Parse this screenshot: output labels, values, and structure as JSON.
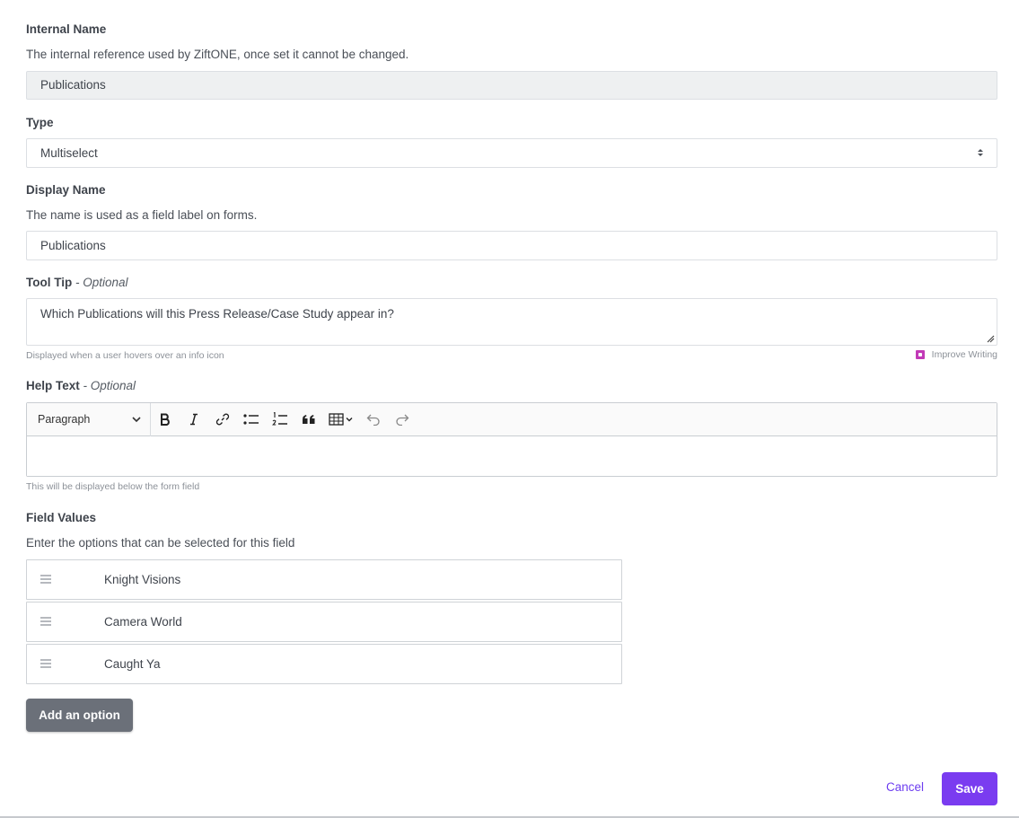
{
  "internal_name": {
    "label": "Internal Name",
    "description": "The internal reference used by ZiftONE, once set it cannot be changed.",
    "value": "Publications"
  },
  "type": {
    "label": "Type",
    "value": "Multiselect"
  },
  "display_name": {
    "label": "Display Name",
    "description": "The name is used as a field label on forms.",
    "value": "Publications"
  },
  "tool_tip": {
    "label": "Tool Tip",
    "optional": "- Optional",
    "value": "Which Publications will this Press Release/Case Study appear in?",
    "hint": "Displayed when a user hovers over an info icon",
    "improve_label": "Improve Writing"
  },
  "help_text": {
    "label": "Help Text",
    "optional": "- Optional",
    "paragraph_select": "Paragraph",
    "hint": "This will be displayed below the form field",
    "toolbar_icons": [
      "bold-icon",
      "italic-icon",
      "link-icon",
      "bulleted-list-icon",
      "numbered-list-icon",
      "blockquote-icon",
      "table-icon",
      "undo-icon",
      "redo-icon"
    ]
  },
  "field_values": {
    "label": "Field Values",
    "description": "Enter the options that can be selected for this field",
    "options": [
      "Knight Visions",
      "Camera World",
      "Caught Ya"
    ],
    "add_label": "Add an option"
  },
  "footer": {
    "cancel_label": "Cancel",
    "save_label": "Save"
  },
  "colors": {
    "accent": "#7a3cf0",
    "link": "#6d3df0",
    "secondary_button": "#6b7079"
  }
}
